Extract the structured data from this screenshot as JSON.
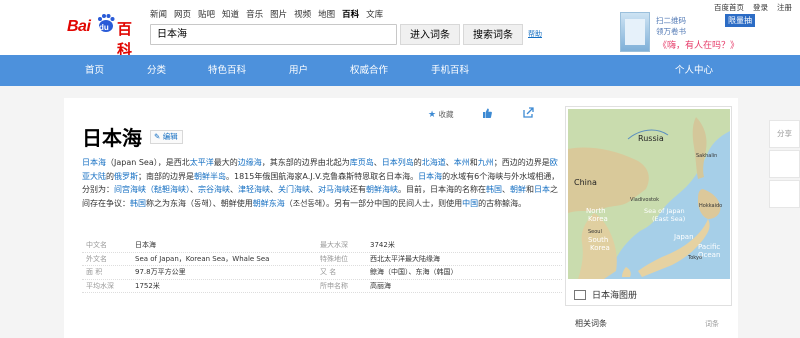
{
  "header": {
    "logo": {
      "bai": "Bai",
      "du": "du",
      "baike": "百科"
    },
    "nav_links": [
      "新闻",
      "网页",
      "贴吧",
      "知道",
      "音乐",
      "图片",
      "视频",
      "地图",
      "百科",
      "文库"
    ],
    "active_nav": "百科",
    "search": {
      "value": "日本海"
    },
    "enter_button": "进入词条",
    "search_button": "搜索词条",
    "help_link": "帮助",
    "top_links": [
      "百度首页",
      "登录",
      "注册"
    ],
    "ad": {
      "line1": "扫二维码",
      "line2": "领万卷书",
      "tag": "限量抽",
      "slogan": "《嗨，有人在吗？》"
    }
  },
  "main_nav": [
    "首页",
    "分类",
    "特色百科",
    "用户",
    "权威合作",
    "手机百科",
    "个人中心"
  ],
  "article": {
    "title": "日本海",
    "edit_label": "编辑",
    "actions": {
      "collect": "收藏",
      "like_count": "",
      "share": ""
    },
    "summary": [
      {
        "t": "日本海",
        "link": true
      },
      {
        "t": "（Japan Sea），是西北",
        "link": false
      },
      {
        "t": "太平洋",
        "link": true
      },
      {
        "t": "最大的",
        "link": false
      },
      {
        "t": "边缘海",
        "link": true
      },
      {
        "t": "，其东部的边界由北起为",
        "link": false
      },
      {
        "t": "库页岛",
        "link": true
      },
      {
        "t": "、",
        "link": false
      },
      {
        "t": "日本列岛",
        "link": true
      },
      {
        "t": "的",
        "link": false
      },
      {
        "t": "北海道",
        "link": true
      },
      {
        "t": "、",
        "link": false
      },
      {
        "t": "本州",
        "link": true
      },
      {
        "t": "和",
        "link": false
      },
      {
        "t": "九州",
        "link": true
      },
      {
        "t": "；西边的边界是",
        "link": false
      },
      {
        "t": "欧亚大陆",
        "link": true
      },
      {
        "t": "的",
        "link": false
      },
      {
        "t": "俄罗斯",
        "link": true
      },
      {
        "t": "；南部的边界是",
        "link": false
      },
      {
        "t": "朝鲜半岛",
        "link": true
      },
      {
        "t": "。1815年俄国航海家A.J.V.克鲁森斯特恩取名日本海。",
        "link": false
      },
      {
        "t": "日本海",
        "link": true
      },
      {
        "t": "的水域有6个海峡与外水域相通，分别为：",
        "link": false
      },
      {
        "t": "间宫海峡（鞑靼海峡）",
        "link": true
      },
      {
        "t": "、",
        "link": false
      },
      {
        "t": "宗谷海峡",
        "link": true
      },
      {
        "t": "、",
        "link": false
      },
      {
        "t": "津轻海峡",
        "link": true
      },
      {
        "t": "、",
        "link": false
      },
      {
        "t": "关门海峡",
        "link": true
      },
      {
        "t": "、",
        "link": false
      },
      {
        "t": "对马海峡",
        "link": true
      },
      {
        "t": "还有",
        "link": false
      },
      {
        "t": "朝鲜海峡",
        "link": true
      },
      {
        "t": "。目前，日本海的名称在",
        "link": false
      },
      {
        "t": "韩国",
        "link": true
      },
      {
        "t": "、",
        "link": false
      },
      {
        "t": "朝鲜",
        "link": true
      },
      {
        "t": "和",
        "link": false
      },
      {
        "t": "日本",
        "link": true
      },
      {
        "t": "之间存在争议：",
        "link": false
      },
      {
        "t": "韩国",
        "link": true
      },
      {
        "t": "称之为东海（동해）、朝鲜使用",
        "link": false
      },
      {
        "t": "朝鲜东海",
        "link": true
      },
      {
        "t": "（조선동해）。另有一部分中国的民间人士，则使用",
        "link": false
      },
      {
        "t": "中国",
        "link": true
      },
      {
        "t": "的古称鲸海。",
        "link": false
      }
    ],
    "basic_info": [
      {
        "k1": "中文名",
        "v1": "日本海",
        "k2": "最大水深",
        "v2": "3742米"
      },
      {
        "k1": "外文名",
        "v1": "Sea of Japan，Korean Sea，Whale Sea",
        "k2": "特殊地位",
        "v2": "西北太平洋最大陆缘海"
      },
      {
        "k1": "面    积",
        "v1": "97.8万平方公里",
        "k2": "又    名",
        "v2": "鲸海（中国）、东海（韩国）"
      },
      {
        "k1": "平均水深",
        "v1": "1752米",
        "k2": "所申名称",
        "v2": "高丽海"
      }
    ]
  },
  "map": {
    "caption": "日本海图册",
    "labels": {
      "russia": "Russia",
      "china": "China",
      "sea1": "Sea of Japan",
      "sea2": "(East Sea)",
      "north": "North",
      "korea_n": "Korea",
      "south": "South",
      "korea_s": "Korea",
      "japan": "Japan",
      "pacific": "Pacific",
      "ocean": "Ocean",
      "hokkaido": "Hokkaido",
      "sakhalin": "Sakhalin",
      "tokyo": "Tokyo",
      "vladivostok": "Vladivostok",
      "seoul": "Seoul"
    }
  },
  "related": {
    "title": "相关词条",
    "more": "词条"
  },
  "side": {
    "share": "分享"
  },
  "colors": {
    "brand_red": "#e10602",
    "nav_blue": "#4d91dc",
    "link_blue": "#136ec2"
  }
}
